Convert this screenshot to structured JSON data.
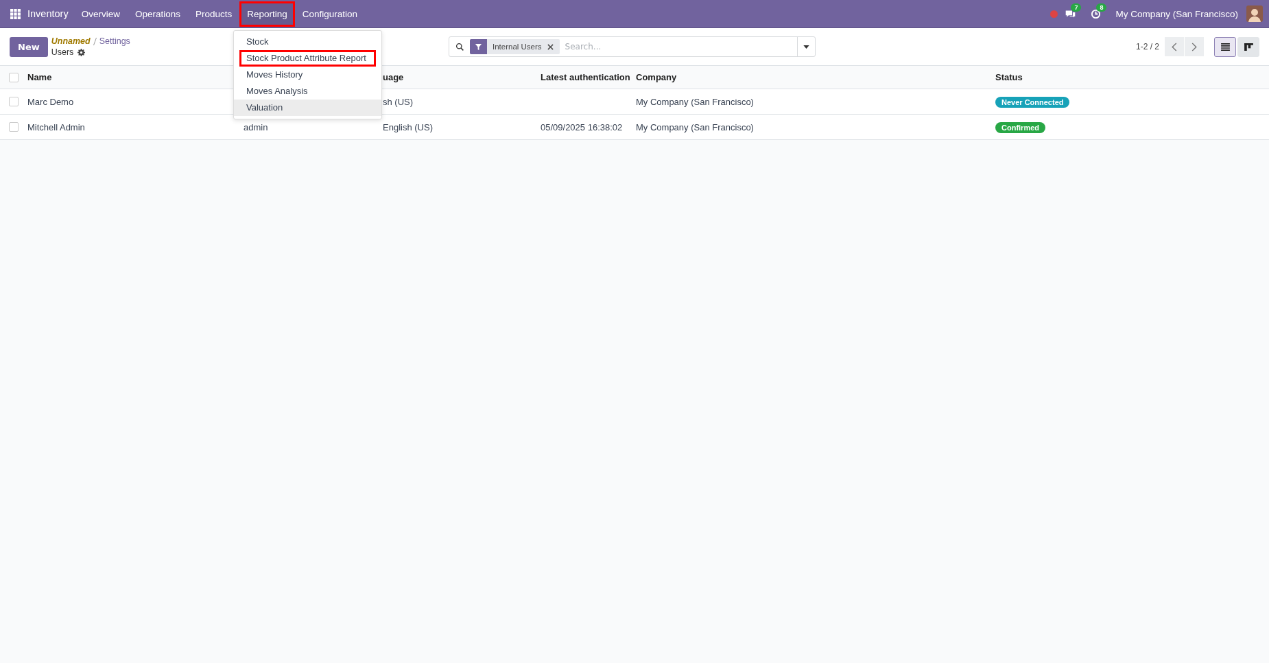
{
  "navbar": {
    "app": "Inventory",
    "menu": [
      {
        "label": "Overview",
        "highlighted": false
      },
      {
        "label": "Operations",
        "highlighted": false
      },
      {
        "label": "Products",
        "highlighted": false
      },
      {
        "label": "Reporting",
        "highlighted": true
      },
      {
        "label": "Configuration",
        "highlighted": false
      }
    ],
    "chat_count": "7",
    "activity_count": "8",
    "company": "My Company (San Francisco)"
  },
  "dropdown": [
    {
      "label": "Stock",
      "highlighted": false,
      "hovered": false
    },
    {
      "label": "Stock Product Attribute Report",
      "highlighted": true,
      "hovered": false
    },
    {
      "label": "Moves History",
      "highlighted": false,
      "hovered": false
    },
    {
      "label": "Moves Analysis",
      "highlighted": false,
      "hovered": false
    },
    {
      "label": "Valuation",
      "highlighted": false,
      "hovered": true
    }
  ],
  "control": {
    "new_button": "New",
    "breadcrumb": [
      "Unnamed",
      "Settings"
    ],
    "title": "Users",
    "facet": "Internal Users",
    "placeholder": "Search...",
    "pager": "1-2 / 2",
    "views": [
      {
        "kind": "list",
        "selected": true
      },
      {
        "kind": "kanban",
        "selected": false
      }
    ]
  },
  "table": {
    "all_checked": false,
    "columns": [
      "Name",
      null,
      "uage",
      "Latest authentication",
      "Company",
      "Status"
    ],
    "rows": [
      {
        "checked": false,
        "name": "Marc Demo",
        "language": "sh (US)",
        "company": "My Company (San Francisco)",
        "status": {
          "label": "Never Connected",
          "kind": "info"
        }
      },
      {
        "checked": false,
        "name": "Mitchell Admin",
        "login": "admin",
        "language": "English (US)",
        "auth": "05/09/2025 16:38:02",
        "company": "My Company (San Francisco)",
        "status": {
          "label": "Confirmed",
          "kind": "success"
        }
      }
    ]
  }
}
